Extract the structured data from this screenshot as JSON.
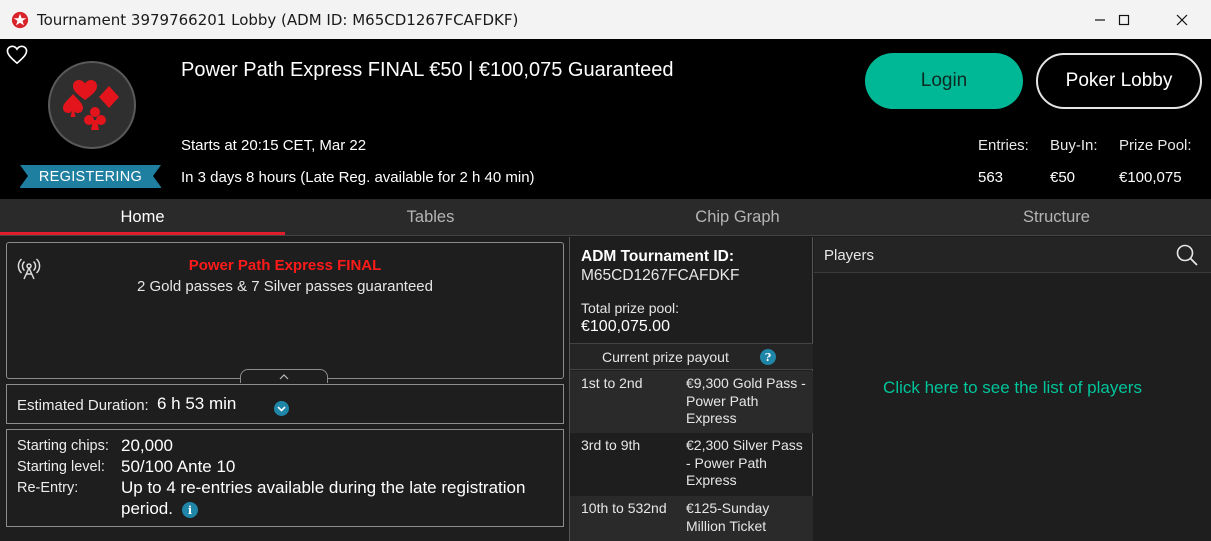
{
  "window": {
    "title": "Tournament 3979766201 Lobby (ADM ID: M65CD1267FCAFDKF)"
  },
  "header": {
    "tournament_name": "Power Path Express FINAL €50 | €100,075 Guaranteed",
    "status_badge": "REGISTERING",
    "starts": "Starts at 20:15 CET, Mar 22",
    "countdown": "In 3 days 8 hours (Late Reg. available for 2 h 40 min)",
    "login_label": "Login",
    "poker_lobby_label": "Poker Lobby",
    "stats": {
      "entries_label": "Entries:",
      "entries_value": "563",
      "buyin_label": "Buy-In:",
      "buyin_value": "€50",
      "prizepool_label": "Prize Pool:",
      "prizepool_value": "€100,075"
    }
  },
  "tabs": [
    {
      "label": "Home",
      "active": true
    },
    {
      "label": "Tables",
      "active": false
    },
    {
      "label": "Chip Graph",
      "active": false
    },
    {
      "label": "Structure",
      "active": false
    }
  ],
  "home": {
    "info_title": "Power Path Express FINAL",
    "info_subtitle": "2 Gold passes & 7 Silver passes guaranteed",
    "estimated_duration_label": "Estimated Duration:",
    "estimated_duration_value": "6 h 53 min",
    "starting_chips_label": "Starting chips:",
    "starting_chips_value": "20,000",
    "starting_level_label": "Starting level:",
    "starting_level_value": "50/100 Ante 10",
    "reentry_label": "Re-Entry:",
    "reentry_value_line1": "Up to 4 re-entries available during the late registration",
    "reentry_value_line2": "period."
  },
  "details": {
    "adm_label": "ADM Tournament ID:",
    "adm_value": "M65CD1267FCAFDKF",
    "total_prize_label": "Total prize pool:",
    "total_prize_value": "€100,075.00",
    "payout_header": "Current prize payout",
    "payouts": [
      {
        "place": "1st to 2nd",
        "prize": "€9,300 Gold Pass - Power Path Express"
      },
      {
        "place": "3rd to 9th",
        "prize": "€2,300 Silver Pass - Power Path Express"
      },
      {
        "place": "10th to 532nd",
        "prize": "€125-Sunday Million Ticket"
      }
    ]
  },
  "players": {
    "title": "Players",
    "link": "Click here to see the list of players"
  },
  "colors": {
    "accent_green": "#00b896",
    "status_blue": "#1f7fa0",
    "tab_red": "#e01e2b",
    "title_red": "#ff1a1a"
  }
}
